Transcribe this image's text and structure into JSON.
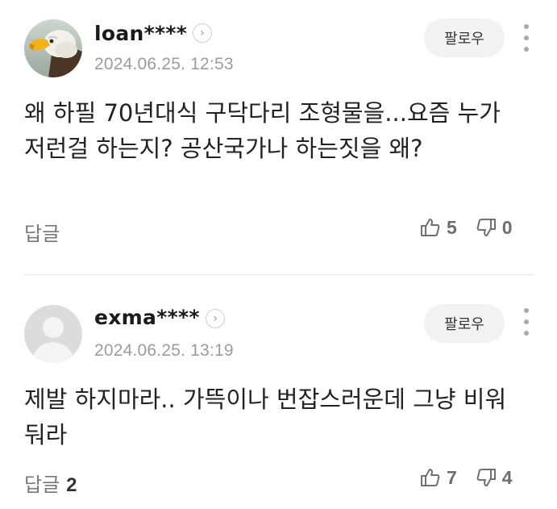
{
  "comments": [
    {
      "username": "loan****",
      "timestamp": "2024.06.25. 12:53",
      "follow_label": "팔로우",
      "text": "왜 하필 70년대식 구닥다리 조형물을...요즘 누가 저런걸 하는지? 공산국가나 하는짓을 왜?",
      "reply_label": "답글",
      "reply_count": "",
      "likes": "5",
      "dislikes": "0",
      "avatar_icon": "eagle-avatar"
    },
    {
      "username": "exma****",
      "timestamp": "2024.06.25. 13:19",
      "follow_label": "팔로우",
      "text": "제발 하지마라.. 가뜩이나 번잡스러운데 그냥 비워둬라",
      "reply_label": "답글",
      "reply_count": "2",
      "likes": "7",
      "dislikes": "4",
      "avatar_icon": "default-user-avatar"
    }
  ],
  "colors": {
    "text_primary": "#1f1f1f",
    "text_muted": "#9c9c9c",
    "follow_bg": "#f2f2f2",
    "divider": "#e6e6e6"
  }
}
